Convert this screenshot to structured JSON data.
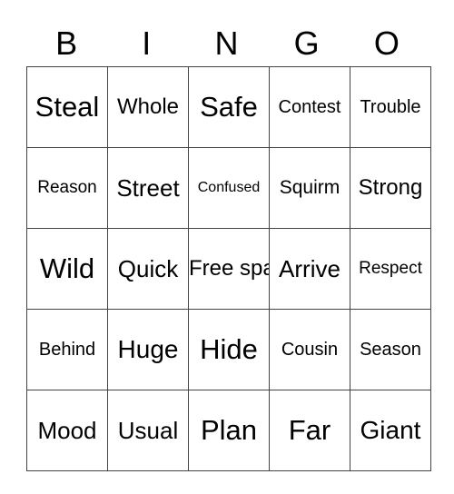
{
  "header": [
    "B",
    "I",
    "N",
    "G",
    "O"
  ],
  "grid": [
    [
      "Steal",
      "Whole",
      "Safe",
      "Contest",
      "Trouble"
    ],
    [
      "Reason",
      "Street",
      "Confused",
      "Squirm",
      "Strong"
    ],
    [
      "Wild",
      "Quick",
      "Free space",
      "Arrive",
      "Respect"
    ],
    [
      "Behind",
      "Huge",
      "Hide",
      "Cousin",
      "Season"
    ],
    [
      "Mood",
      "Usual",
      "Plan",
      "Far",
      "Giant"
    ]
  ]
}
